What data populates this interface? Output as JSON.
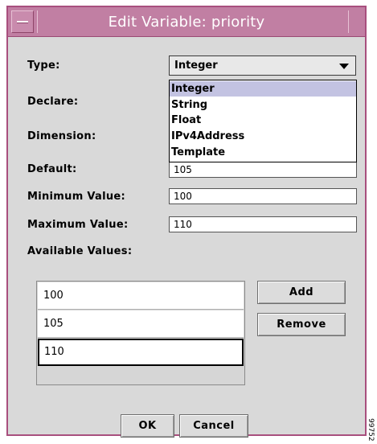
{
  "window": {
    "title": "Edit Variable: priority"
  },
  "form": {
    "type_label": "Type:",
    "declare_label": "Declare:",
    "dimension_label": "Dimension:",
    "default_label": "Default:",
    "default_value": "105",
    "min_label": "Minimum Value:",
    "min_value": "100",
    "max_label": "Maximum Value:",
    "max_value": "110",
    "available_label": "Available Values:"
  },
  "type_combo": {
    "selected": "Integer",
    "options": [
      "Integer",
      "String",
      "Float",
      "IPv4Address",
      "Template"
    ],
    "highlighted_index": 0
  },
  "available_values": [
    "100",
    "105",
    "110"
  ],
  "buttons": {
    "add": "Add",
    "remove": "Remove",
    "ok": "OK",
    "cancel": "Cancel"
  },
  "figure_id": "99752"
}
